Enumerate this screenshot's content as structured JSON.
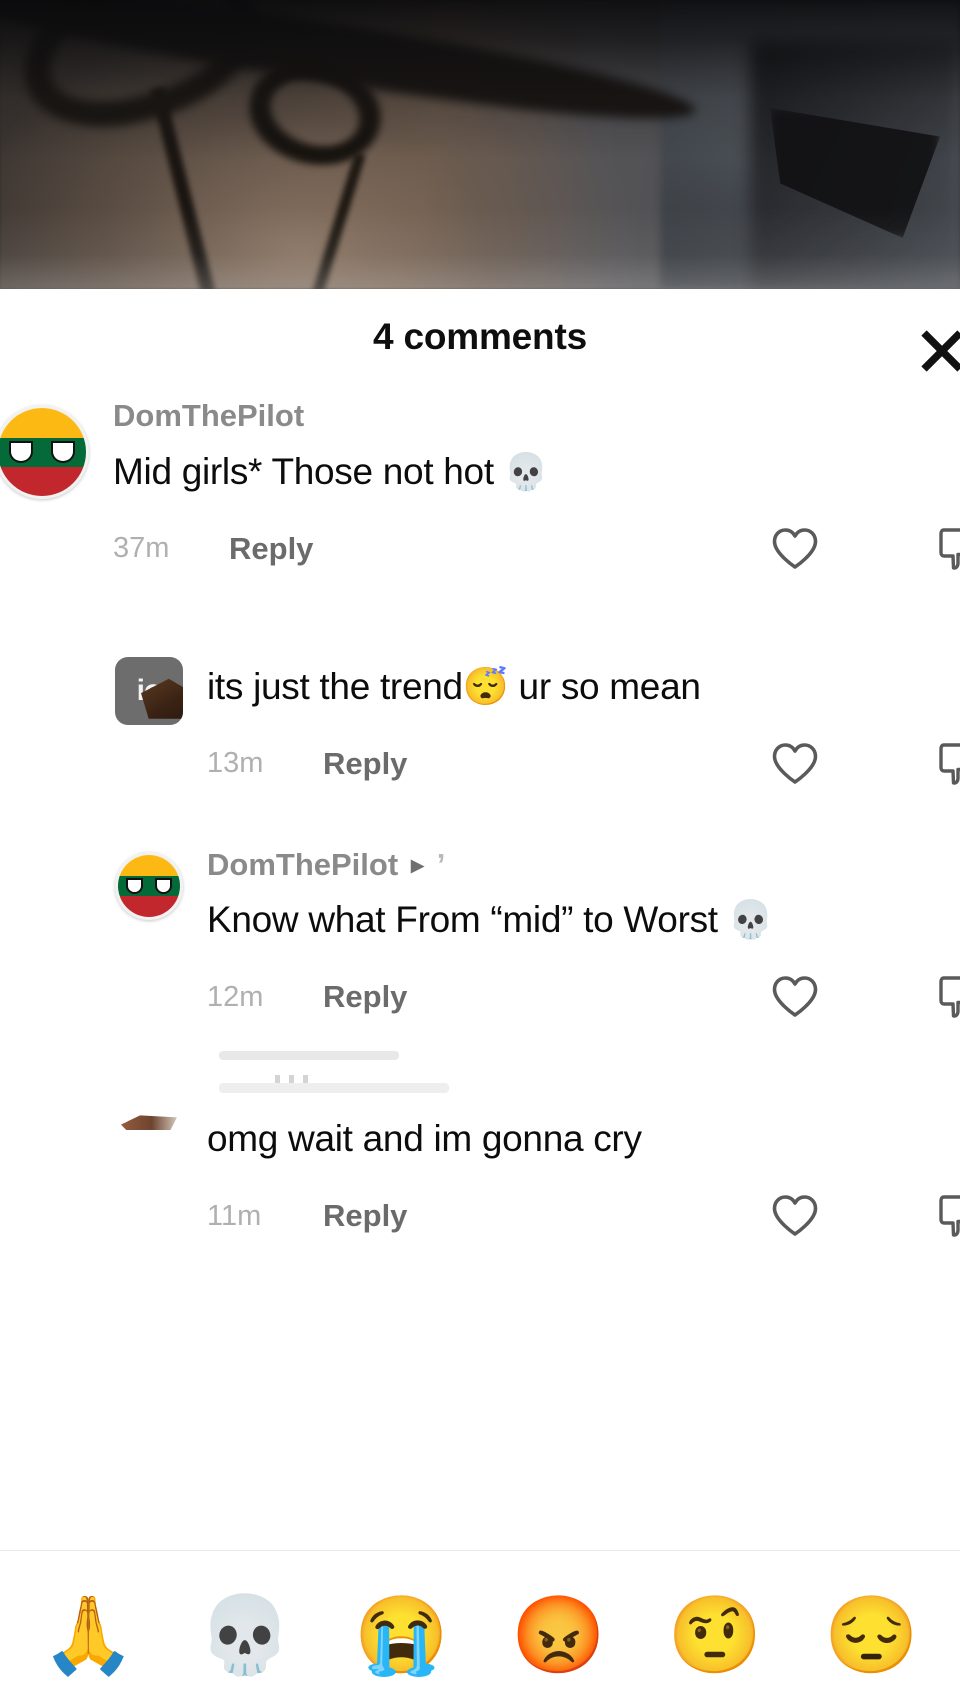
{
  "screen": {
    "app": "tiktok-comments-sheet",
    "background": "blurred-video-frame"
  },
  "header": {
    "title": "4 comments",
    "close_icon": "close-icon"
  },
  "colors": {
    "sheet_background": "#ffffff",
    "title_text": "#0e0e0e",
    "username_text": "#8a8a8a",
    "comment_text": "#0c0c0c",
    "timestamp_text": "#b0b0b0",
    "reply_text": "#6b6b6b",
    "icon_stroke": "#5a5a5a",
    "avatar_square_bg": "#6d6d6d",
    "flag_yellow": "#FDB913",
    "flag_green": "#046A38",
    "flag_red": "#C1272D"
  },
  "comments": [
    {
      "id": "c1",
      "level": 0,
      "avatar": "lithuania-countryball-avatar",
      "username": "DomThePilot",
      "reply_to": "",
      "text": "Mid girls* Those not hot ",
      "emoji": "💀",
      "time": "37m",
      "reply_label": "Reply",
      "like_icon": "heart-icon",
      "dislike_icon": "thumbs-down-icon"
    },
    {
      "id": "c2",
      "level": 1,
      "avatar": "io-square-avatar",
      "avatar_label": "io",
      "username": "",
      "reply_to": "",
      "text": "its just the trend😴 ur so mean",
      "emoji": "",
      "time": "13m",
      "reply_label": "Reply",
      "like_icon": "heart-icon",
      "dislike_icon": "thumbs-down-icon"
    },
    {
      "id": "c3",
      "level": 1,
      "avatar": "lithuania-countryball-avatar",
      "username": "DomThePilot",
      "reply_arrow": "▸",
      "reply_to": "’",
      "text": "Know what From “mid” to Worst 💀",
      "emoji": "",
      "time": "12m",
      "reply_label": "Reply",
      "like_icon": "heart-icon",
      "dislike_icon": "thumbs-down-icon"
    },
    {
      "id": "c4",
      "level": 1,
      "avatar": "faded-avatar",
      "username": "",
      "reply_to": "",
      "text": "omg wait and im gonna cry",
      "emoji": "",
      "time": "11m",
      "reply_label": "Reply",
      "like_icon": "heart-icon",
      "dislike_icon": "thumbs-down-icon"
    }
  ],
  "emoji_bar": {
    "items": [
      {
        "glyph": "🙏",
        "name": "folded-hands-emoji"
      },
      {
        "glyph": "💀",
        "name": "skull-emoji"
      },
      {
        "glyph": "😭",
        "name": "loudly-crying-face-emoji"
      },
      {
        "glyph": "😡",
        "name": "enraged-face-emoji"
      },
      {
        "glyph": "🤨",
        "name": "face-with-raised-eyebrow-emoji"
      },
      {
        "glyph": "😔",
        "name": "pensive-face-emoji"
      }
    ]
  }
}
